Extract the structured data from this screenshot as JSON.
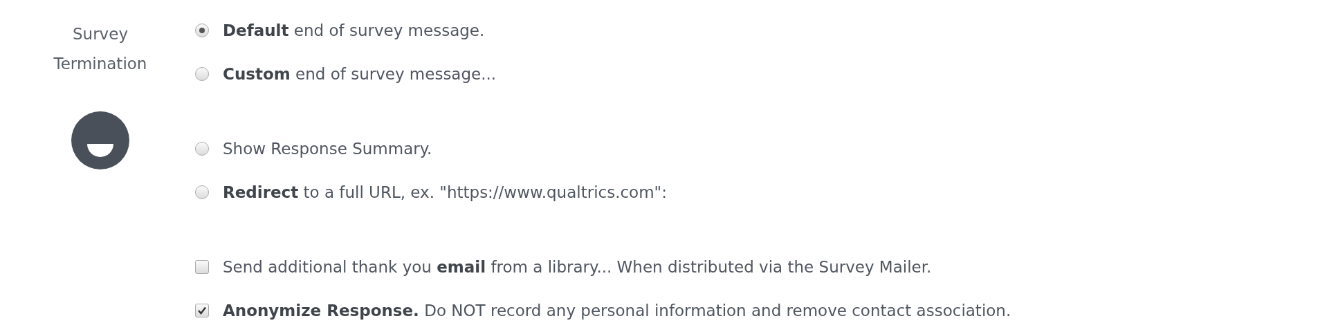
{
  "section": {
    "label_lines": [
      "Survey",
      "Termination"
    ]
  },
  "message_options": [
    {
      "text": "**Default** end of survey message.",
      "selected": true
    },
    {
      "text": "**Custom** end of survey message...",
      "selected": false
    }
  ],
  "action_options": [
    {
      "text": "Show Response Summary.",
      "selected": false
    },
    {
      "text": "**Redirect** to a full URL, ex. \"https://www.qualtrics.com\":",
      "selected": false
    }
  ],
  "settings": [
    {
      "text": "Send additional thank you **email** from a library... When distributed via the Survey Mailer.",
      "checked": false
    },
    {
      "text": "**Anonymize Response.** Do NOT record any personal information and remove contact association.",
      "checked": true
    }
  ]
}
